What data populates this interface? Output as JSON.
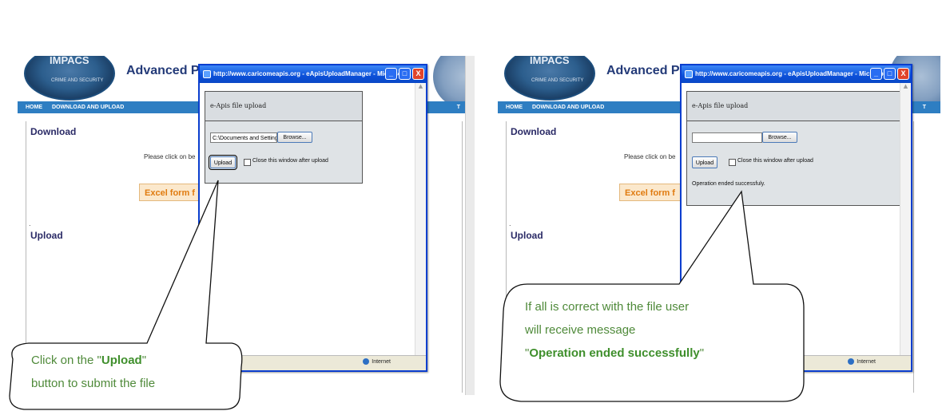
{
  "site": {
    "logo_text": "IMPACS",
    "logo_sub": "CRIME AND SECURITY",
    "title": "Advanced Pa",
    "nav_home": "HOME",
    "nav_download_upload": "DOWNLOAD AND UPLOAD",
    "nav_right_fragment": "T",
    "download_heading": "Download",
    "please_text": "Please click on be",
    "excel_left": "Excel form f",
    "excel_right": "Excel form f",
    "dot": ".",
    "upload_heading": "Upload"
  },
  "popup_left": {
    "window_title": "http://www.caricomeapis.org - eApisUploadManager - Microsoft...",
    "box_title": "e-Apis file upload",
    "file_value": "C:\\Documents and Setting",
    "browse_label": "Browse...",
    "upload_label": "Upload",
    "close_checkbox_label": "Close this window after upload",
    "close_checked": false,
    "status_zone": "Internet"
  },
  "popup_right": {
    "window_title": "http://www.caricomeapis.org - eApisUploadManager - Microsoft...",
    "box_title": "e-Apis file upload",
    "file_value": "",
    "browse_label": "Browse...",
    "upload_label": "Upload",
    "close_checkbox_label": "Close this window after upload",
    "close_checked": false,
    "result_message": "Operation ended successfuly.",
    "status_zone": "Internet"
  },
  "callouts": {
    "left": {
      "line1_pre": "Click  on the \"",
      "line1_bold": "Upload",
      "line1_post": "\"",
      "line2": "button to submit the file"
    },
    "right": {
      "line1": "If all is correct with the file  user",
      "line2": "will receive message",
      "line3_pre": "\"",
      "line3_bold": "Operation ended successfully",
      "line3_post": "\""
    },
    "accent_color": "#4f8a3a",
    "bold_color": "#3f8f2c"
  },
  "colors": {
    "titlebar": "#0b4fd8",
    "navbar": "#2e7ec2",
    "site_title": "#233a78",
    "excel_text": "#e07b10"
  }
}
